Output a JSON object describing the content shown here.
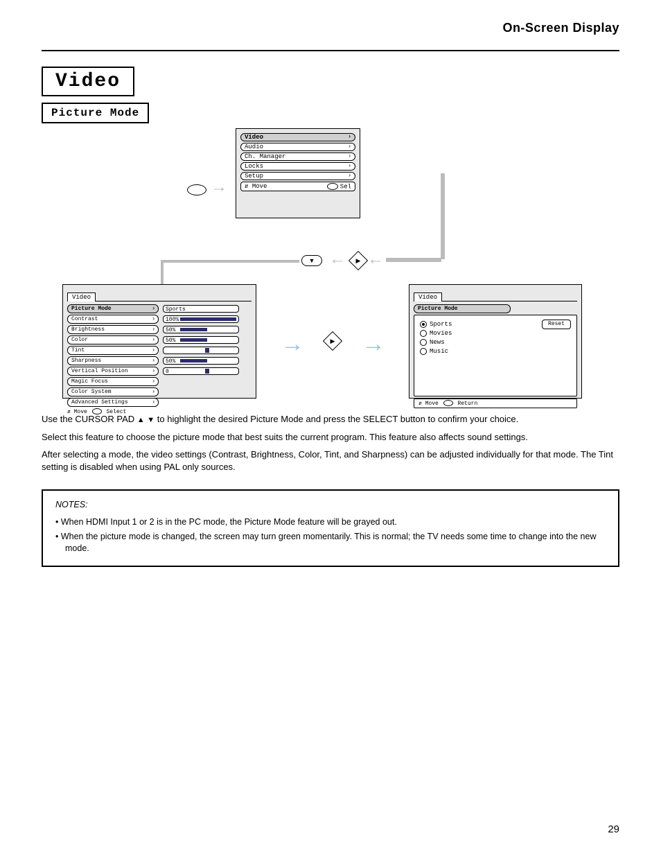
{
  "chapter_label": "On-Screen Display",
  "h1": "Video",
  "h2": "Picture Mode",
  "main_menu": {
    "items": [
      "Video",
      "Audio",
      "Ch. Manager",
      "Locks",
      "Setup"
    ],
    "hint_move": "Move",
    "hint_sel": "Sel"
  },
  "video_detail": {
    "tab": "Video",
    "rows": [
      {
        "label": "Picture Mode",
        "value": "Sports",
        "bar": null,
        "highlight": true
      },
      {
        "label": "Contrast",
        "value": "100%",
        "bar": 1.0
      },
      {
        "label": "Brightness",
        "value": "50%",
        "bar": 0.5
      },
      {
        "label": "Color",
        "value": "50%",
        "bar": 0.5
      },
      {
        "label": "Tint",
        "value": "",
        "tick": 0.5
      },
      {
        "label": "Sharpness",
        "value": "50%",
        "bar": 0.5
      },
      {
        "label": "Vertical Position",
        "value": "0",
        "tick": 0.5
      },
      {
        "label": "Magic Focus",
        "value": null
      },
      {
        "label": "Color System",
        "value": null
      },
      {
        "label": "Advanced Settings",
        "value": null
      }
    ],
    "hint_move": "Move",
    "hint_select": "Select"
  },
  "picture_mode_modal": {
    "tab": "Video",
    "heading": "Picture Mode",
    "reset": "Reset",
    "options": [
      {
        "label": "Sports",
        "selected": true
      },
      {
        "label": "Movies",
        "selected": false
      },
      {
        "label": "News",
        "selected": false
      },
      {
        "label": "Music",
        "selected": false
      }
    ],
    "hint_move": "Move",
    "hint_return": "Return"
  },
  "body": {
    "p1_a": "Use the CURSOR PAD ",
    "p1_b": " to highlight the desired Picture Mode and press the SELECT button to confirm your choice.",
    "p2": "Select this feature to choose the picture mode that best suits the current program. This feature also affects sound settings.",
    "p3": "After selecting a mode, the video settings (Contrast, Brightness, Color, Tint, and Sharpness) can be adjusted individually for that mode. The Tint setting is disabled when using PAL only sources.",
    "note_title": "NOTES:",
    "notes": [
      "When HDMI Input 1 or 2 is in the PC mode, the Picture Mode feature will be grayed out.",
      "When the picture mode is changed, the screen may turn green momentarily.  This is normal; the TV needs some time to change into the new mode."
    ]
  },
  "page_number": "29"
}
